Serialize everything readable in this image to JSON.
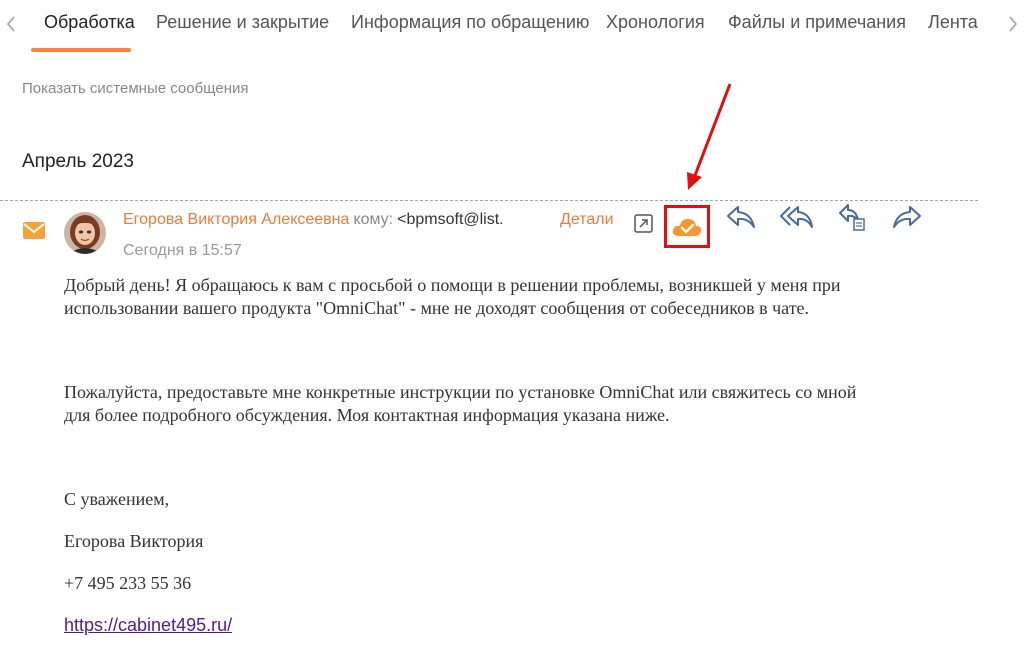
{
  "tabs": {
    "items": [
      {
        "label": "Обработка"
      },
      {
        "label": "Решение и закрытие"
      },
      {
        "label": "Информация по обращению"
      },
      {
        "label": "Хронология"
      },
      {
        "label": "Файлы и примечания"
      },
      {
        "label": "Лента"
      }
    ],
    "active_index": 0
  },
  "feed": {
    "show_system_label": "Показать системные сообщения",
    "month_header": "Апрель 2023"
  },
  "email": {
    "sender": "Егорова Виктория Алексеевна",
    "to_label": "кому:",
    "recipient": "<bpmsoft@list.",
    "details_label": "Детали",
    "timestamp": "Сегодня в 15:57",
    "body": {
      "p1_line1": "Добрый день! Я обращаюсь к вам с просьбой о помощи в решении проблемы, возникшей у меня при",
      "p1_line2": "использовании вашего продукта \"OmniChat\" - мне не доходят сообщения от собеседников в чате.",
      "p2_line1": "Пожалуйста, предоставьте мне конкретные инструкции по установке OmniChat или свяжитесь со мной",
      "p2_line2": "для более подробного обсуждения. Моя контактная информация указана ниже.",
      "closing": "С уважением,",
      "signature_name": "Егорова Виктория",
      "phone": "+7 495 233 55 36",
      "link": "https://cabinet495.ru/"
    },
    "actions": [
      "open-external-icon",
      "cloud-check-icon",
      "reply-icon",
      "reply-all-icon",
      "reply-with-template-icon",
      "forward-icon"
    ]
  },
  "colors": {
    "accent": "#f07a3c",
    "tab_underline": "#ff8040",
    "highlight_box": "#e01010",
    "icon_blue": "#4a6b9a"
  }
}
